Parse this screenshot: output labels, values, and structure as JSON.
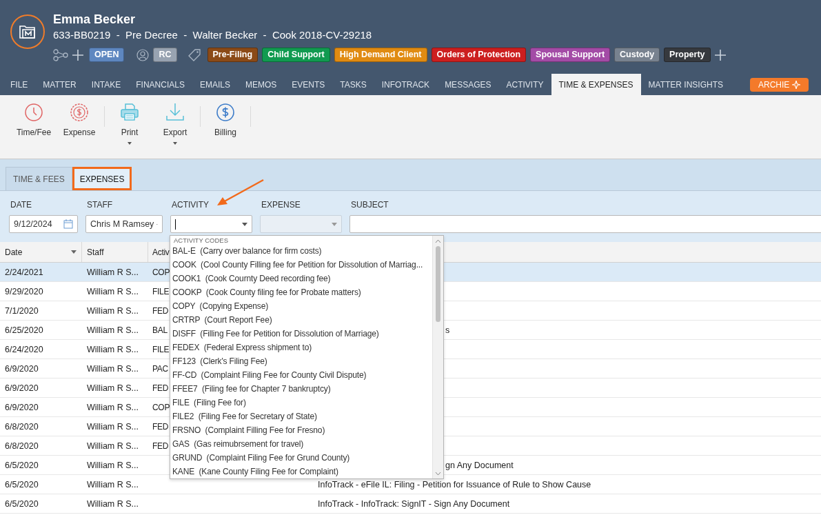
{
  "matter": {
    "name": "Emma Becker",
    "subtitle": "633-BB0219  -  Pre Decree  -  Walter Becker  -  Cook 2018-CV-29218",
    "status": "OPEN",
    "initials": "RC",
    "tags": [
      {
        "label": "Pre-Filing",
        "color": "#8b4a17"
      },
      {
        "label": "Child Support",
        "color": "#119a50"
      },
      {
        "label": "High Demand Client",
        "color": "#e08b12"
      },
      {
        "label": "Orders of Protection",
        "color": "#cc1f1f"
      },
      {
        "label": "Spousal Support",
        "color": "#a34ba6"
      },
      {
        "label": "Custody",
        "color": "#78828f"
      },
      {
        "label": "Property",
        "color": "#36393e"
      }
    ]
  },
  "nav_tabs": [
    {
      "label": "FILE",
      "selected": false
    },
    {
      "label": "MATTER",
      "selected": false
    },
    {
      "label": "INTAKE",
      "selected": false
    },
    {
      "label": "FINANCIALS",
      "selected": false
    },
    {
      "label": "EMAILS",
      "selected": false
    },
    {
      "label": "MEMOS",
      "selected": false
    },
    {
      "label": "EVENTS",
      "selected": false
    },
    {
      "label": "TASKS",
      "selected": false
    },
    {
      "label": "INFOTRACK",
      "selected": false
    },
    {
      "label": "MESSAGES",
      "selected": false
    },
    {
      "label": "ACTIVITY",
      "selected": false
    },
    {
      "label": "TIME & EXPENSES",
      "selected": true
    },
    {
      "label": "MATTER INSIGHTS",
      "selected": false
    }
  ],
  "archie_button": "ARCHIE",
  "toolbar": [
    {
      "label": "Time/Fee",
      "kind": "clock",
      "dropdown": false
    },
    {
      "label": "Expense",
      "kind": "expense",
      "dropdown": false
    },
    {
      "kind": "separator"
    },
    {
      "label": "Print",
      "kind": "print",
      "dropdown": true
    },
    {
      "label": "Export",
      "kind": "export",
      "dropdown": true
    },
    {
      "kind": "separator"
    },
    {
      "label": "Billing",
      "kind": "billing",
      "dropdown": false
    },
    {
      "kind": "separator"
    }
  ],
  "sub_tabs": [
    {
      "label": "TIME & FEES",
      "selected": false,
      "highlighted": false
    },
    {
      "label": "EXPENSES",
      "selected": true,
      "highlighted": true
    }
  ],
  "form": {
    "fields": [
      {
        "label": "DATE",
        "kind": "date",
        "value": "9/12/2024"
      },
      {
        "label": "STAFF",
        "kind": "select",
        "value": "Chris M Ramsey"
      },
      {
        "label": "ACTIVITY",
        "kind": "select",
        "focused": true
      },
      {
        "label": "EXPENSE",
        "kind": "select",
        "disabled": true
      },
      {
        "label": "SUBJECT",
        "kind": "text"
      }
    ]
  },
  "table": {
    "columns": [
      {
        "label": "Date",
        "sorted": true
      },
      {
        "label": "Staff",
        "sorted": false
      },
      {
        "label": "Activ",
        "sorted": false
      }
    ],
    "rows": [
      {
        "date": "2/24/2021",
        "staff": "William R S...",
        "activity": "COP",
        "selected": true
      },
      {
        "date": "9/29/2020",
        "staff": "William R S...",
        "activity": "FILE",
        "selected": false
      },
      {
        "date": "7/1/2020",
        "staff": "William R S...",
        "activity": "FED",
        "selected": false
      },
      {
        "date": "6/25/2020",
        "staff": "William R S...",
        "activity": "BAL",
        "subject": "s",
        "selected": false
      },
      {
        "date": "6/24/2020",
        "staff": "William R S...",
        "activity": "FILE",
        "selected": false
      },
      {
        "date": "6/9/2020",
        "staff": "William R S...",
        "activity": "PAC",
        "selected": false
      },
      {
        "date": "6/9/2020",
        "staff": "William R S...",
        "activity": "FED",
        "selected": false
      },
      {
        "date": "6/9/2020",
        "staff": "William R S...",
        "activity": "COP",
        "selected": false
      },
      {
        "date": "6/8/2020",
        "staff": "William R S...",
        "activity": "FED",
        "selected": false
      },
      {
        "date": "6/8/2020",
        "staff": "William R S...",
        "activity": "FED",
        "selected": false
      },
      {
        "date": "6/5/2020",
        "staff": "William R S...",
        "subject": "gn Any Document",
        "selected": false
      },
      {
        "date": "6/5/2020",
        "staff": "William R S...",
        "subject": "InfoTrack - eFile IL: Filing - Petition for Issuance of Rule to Show Cause",
        "selected": false
      },
      {
        "date": "6/5/2020",
        "staff": "William R S...",
        "subject": "InfoTrack - InfoTrack: SignIT - Sign Any Document",
        "selected": false
      }
    ]
  },
  "dropdown": {
    "heading": "ACTIVITY CODES",
    "items": [
      "BAL-E  (Carry over balance for firm costs)",
      "COOK  (Cool County Filling fee for Petition for Dissolution of Marriag...",
      "COOK1  (Cook Cournty Deed recording fee)",
      "COOKP  (Cook County filing fee for Probate matters)",
      "COPY  (Copying Expense)",
      "CRTRP  (Court Report Fee)",
      "DISFF  (Filling Fee for Petition for Dissolution of Marriage)",
      "FEDEX  (Federal Express shipment to)",
      "FF123  (Clerk's Filing Fee)",
      "FF-CD  (Complaint Filing Fee for County Civil Dispute)",
      "FFEE7  (Filing fee for Chapter 7 bankruptcy)",
      "FILE  (Filing Fee for)",
      "FILE2  (Filing Fee for Secretary of State)",
      "FRSNO  (Complaint Filling Fee for Fresno)",
      "GAS  (Gas reimubrsement for travel)",
      "GRUND  (Complaint Filing Fee for Grund County)",
      "KANE  (Kane County Filing Fee for Complaint)"
    ]
  }
}
